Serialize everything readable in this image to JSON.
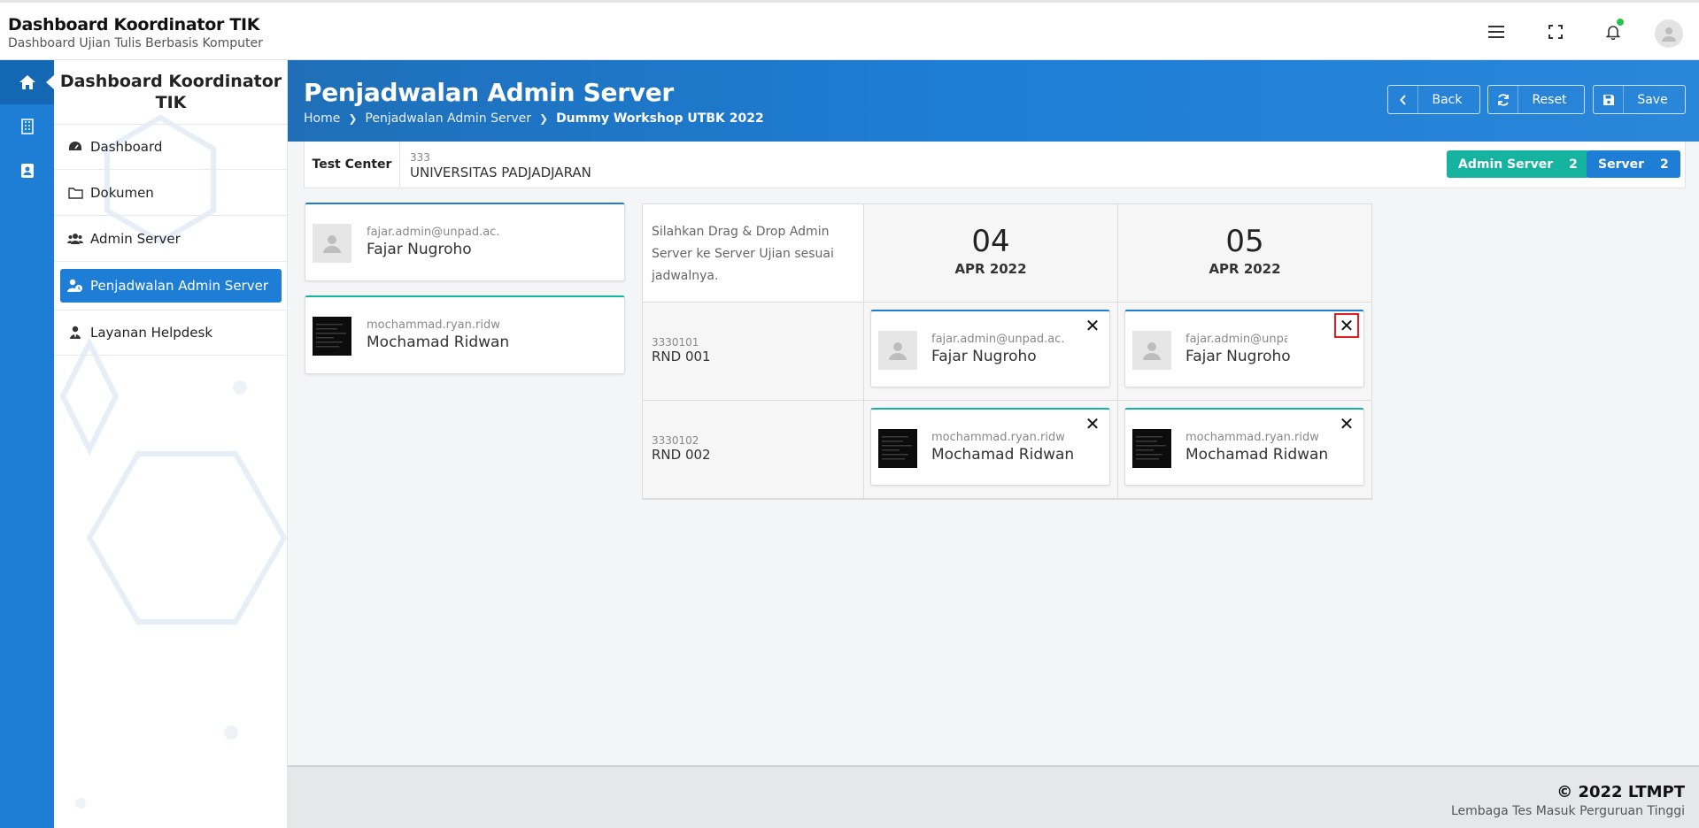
{
  "app": {
    "title": "Dashboard Koordinator TIK",
    "subtitle": "Dashboard Ujian Tulis Berbasis Komputer"
  },
  "topbar": {
    "icons": [
      "menu-icon",
      "fullscreen-icon",
      "bell-icon",
      "user-avatar"
    ]
  },
  "rail": {
    "items": [
      "home-icon",
      "building-icon",
      "contact-icon"
    ]
  },
  "sidebar": {
    "title": "Dashboard Koordinator TIK",
    "items": [
      {
        "label": "Dashboard",
        "icon": "gauge-icon"
      },
      {
        "label": "Dokumen",
        "icon": "folder-icon"
      },
      {
        "label": "Admin Server",
        "icon": "users-icon"
      },
      {
        "label": "Penjadwalan Admin Server",
        "icon": "user-clock-icon",
        "active": true
      },
      {
        "label": "Layanan Helpdesk",
        "icon": "user-tie-icon"
      }
    ]
  },
  "header": {
    "title": "Penjadwalan Admin Server",
    "breadcrumb": [
      "Home",
      "Penjadwalan Admin Server",
      "Dummy Workshop UTBK 2022"
    ],
    "buttons": {
      "back": "Back",
      "reset": "Reset",
      "save": "Save"
    }
  },
  "test_center": {
    "label": "Test Center",
    "code": "333",
    "name": "UNIVERSITAS PADJADJARAN",
    "badges": [
      {
        "label": "Admin Server",
        "count": "2",
        "color": "#16b4a0"
      },
      {
        "label": "Server",
        "count": "2",
        "color": "#1e7ed6"
      }
    ]
  },
  "pool": [
    {
      "email": "fajar.admin@unpad.ac.id",
      "name": "Fajar Nugroho",
      "avatar": "placeholder"
    },
    {
      "email": "mochammad.ryan.ridwan",
      "name": "Mochamad Ridwan",
      "avatar": "photo-dark"
    }
  ],
  "schedule": {
    "instruction": "Silahkan Drag & Drop Admin Server ke Server Ujian sesuai jadwalnya.",
    "dates": [
      {
        "day": "04",
        "month": "APR 2022"
      },
      {
        "day": "05",
        "month": "APR 2022"
      }
    ],
    "servers": [
      {
        "code": "3330101",
        "name": "RND 001"
      },
      {
        "code": "3330102",
        "name": "RND 002"
      }
    ],
    "cells": [
      [
        {
          "email": "fajar.admin@unpad.ac.id",
          "name": "Fajar Nugroho"
        },
        {
          "email": "fajar.admin@unpad.ac.id",
          "name": "Fajar Nugroho"
        }
      ],
      [
        {
          "email": "mochammad.ryan.ridwan",
          "name": "Mochamad Ridwan"
        },
        {
          "email": "mochammad.ryan.ridwan",
          "name": "Mochamad Ridwan"
        }
      ]
    ],
    "remove_symbol": "✕"
  },
  "footer": {
    "copyright": "© 2022 LTMPT",
    "org": "Lembaga Tes Masuk Perguruan Tinggi"
  },
  "colors": {
    "primary": "#1e7ed6",
    "teal": "#16b4a0",
    "highlight": "#e01f1f"
  }
}
